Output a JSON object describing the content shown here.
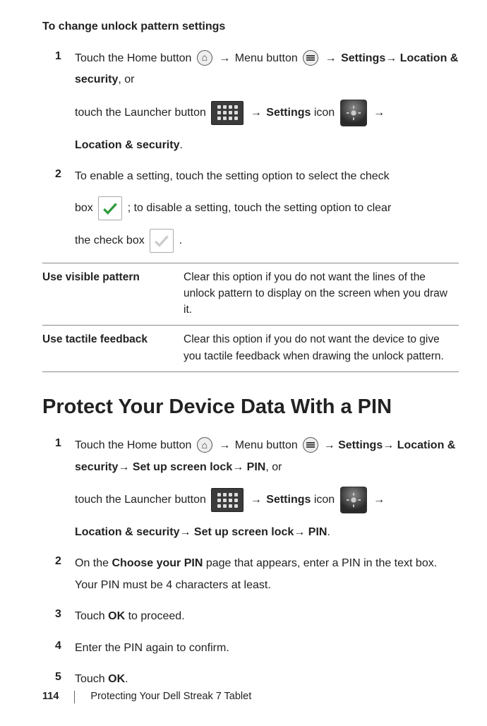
{
  "section1": {
    "title": "To change unlock pattern settings",
    "step1": {
      "num": "1",
      "textA1": "Touch the Home button ",
      "arrow": "→",
      "textA2": " Menu button ",
      "settings": "Settings",
      "locsec": "Location & security",
      "or": ", or",
      "lineB1": "touch the Launcher button ",
      "settingsIcon": "Settings",
      "iconWord": " icon ",
      "lineB3": "Location & security",
      "period": "."
    },
    "step2": {
      "num": "2",
      "t1": "To enable a setting, touch the setting option to select the check",
      "t2": "box ",
      "t3": "; to disable a setting, touch the setting option to clear",
      "t4": "the check box ",
      "t5": "."
    },
    "table": [
      {
        "label": "Use visible pattern",
        "desc": "Clear this option if you do not want the lines of the unlock pattern to display on the screen when you draw it."
      },
      {
        "label": "Use tactile feedback",
        "desc": "Clear this option if you do not want the device to give you tactile feedback when drawing the unlock pattern."
      }
    ]
  },
  "section2": {
    "heading": "Protect Your Device Data With a PIN",
    "steps": [
      {
        "num": "1",
        "lineA": {
          "t1": "Touch the Home button ",
          "arrow": "→",
          "t2": " Menu button ",
          "settings": "Settings",
          "locsec": "Location & security",
          "setup": " Set up screen lock",
          "pin": " PIN",
          "or": ", or"
        },
        "lineB": {
          "t1": "touch the Launcher button ",
          "settings": "Settings",
          "iconWord": " icon ",
          "arrow": "→",
          "locsec": "Location & security",
          "setup": " Set up screen lock",
          "pin": " PIN",
          "period": "."
        }
      },
      {
        "num": "2",
        "pre": "On the ",
        "bold": "Choose your PIN",
        "post": " page that appears, enter a PIN in the text box. Your PIN must be 4 characters at least."
      },
      {
        "num": "3",
        "pre": "Touch ",
        "bold": "OK",
        "post": " to proceed."
      },
      {
        "num": "4",
        "text": "Enter the PIN again to confirm."
      },
      {
        "num": "5",
        "pre": "Touch ",
        "bold": "OK",
        "post": "."
      }
    ]
  },
  "footer": {
    "page": "114",
    "title": "Protecting Your Dell Streak 7 Tablet"
  }
}
